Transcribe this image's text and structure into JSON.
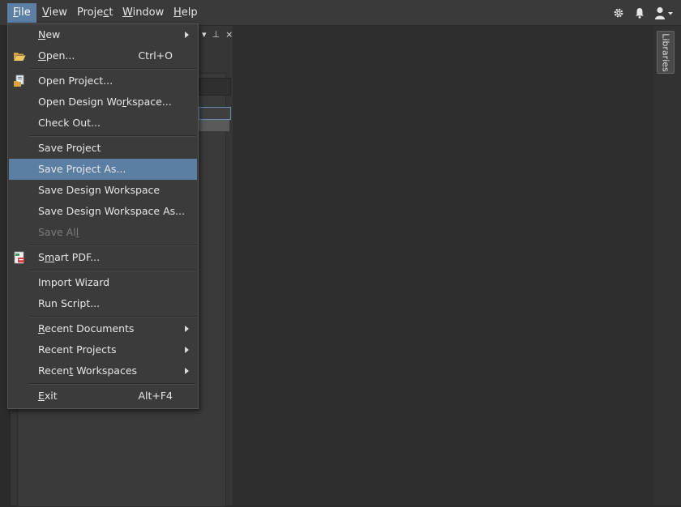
{
  "menubar": {
    "items": [
      {
        "label": "File",
        "mnemonic": "F",
        "rest": "ile"
      },
      {
        "label": "View",
        "mnemonic": "V",
        "rest": "iew"
      },
      {
        "label": "Project",
        "prefix": "Proje",
        "mnemonic": "c",
        "rest": "t"
      },
      {
        "label": "Window",
        "mnemonic": "W",
        "rest": "indow"
      },
      {
        "label": "Help",
        "mnemonic": "H",
        "rest": "elp"
      }
    ],
    "right_icons": [
      "gear-icon",
      "bell-icon",
      "user-icon"
    ]
  },
  "panel": {
    "controls": [
      "▾",
      "⊥",
      "×"
    ]
  },
  "right_dock": {
    "tab": "Libraries"
  },
  "file_menu": {
    "items": [
      {
        "label": "New",
        "mnemonic_index": 0,
        "submenu": true
      },
      {
        "label": "Open...",
        "mnemonic_index": 0,
        "shortcut": "Ctrl+O",
        "icon": "folder-open-icon"
      },
      {
        "label": "Open Project...",
        "icon": "open-project-icon"
      },
      {
        "label": "Open Design Workspace...",
        "mnemonic_index": 14
      },
      {
        "label": "Check Out..."
      },
      {
        "label": "Save Project"
      },
      {
        "label": "Save Project As...",
        "selected": true
      },
      {
        "label": "Save Design Workspace"
      },
      {
        "label": "Save Design Workspace As..."
      },
      {
        "label": "Save All",
        "disabled": true,
        "mnemonic_index": 7
      },
      {
        "label": "Smart PDF...",
        "mnemonic_index": 1,
        "icon": "pdf-icon"
      },
      {
        "label": "Import Wizard"
      },
      {
        "label": "Run Script..."
      },
      {
        "label": "Recent Documents",
        "mnemonic_index": 0,
        "submenu": true
      },
      {
        "label": "Recent Projects",
        "submenu": true
      },
      {
        "label": "Recent Workspaces",
        "mnemonic_index": 5,
        "submenu": true
      },
      {
        "label": "Exit",
        "mnemonic_index": 0,
        "shortcut": "Alt+F4"
      }
    ]
  }
}
